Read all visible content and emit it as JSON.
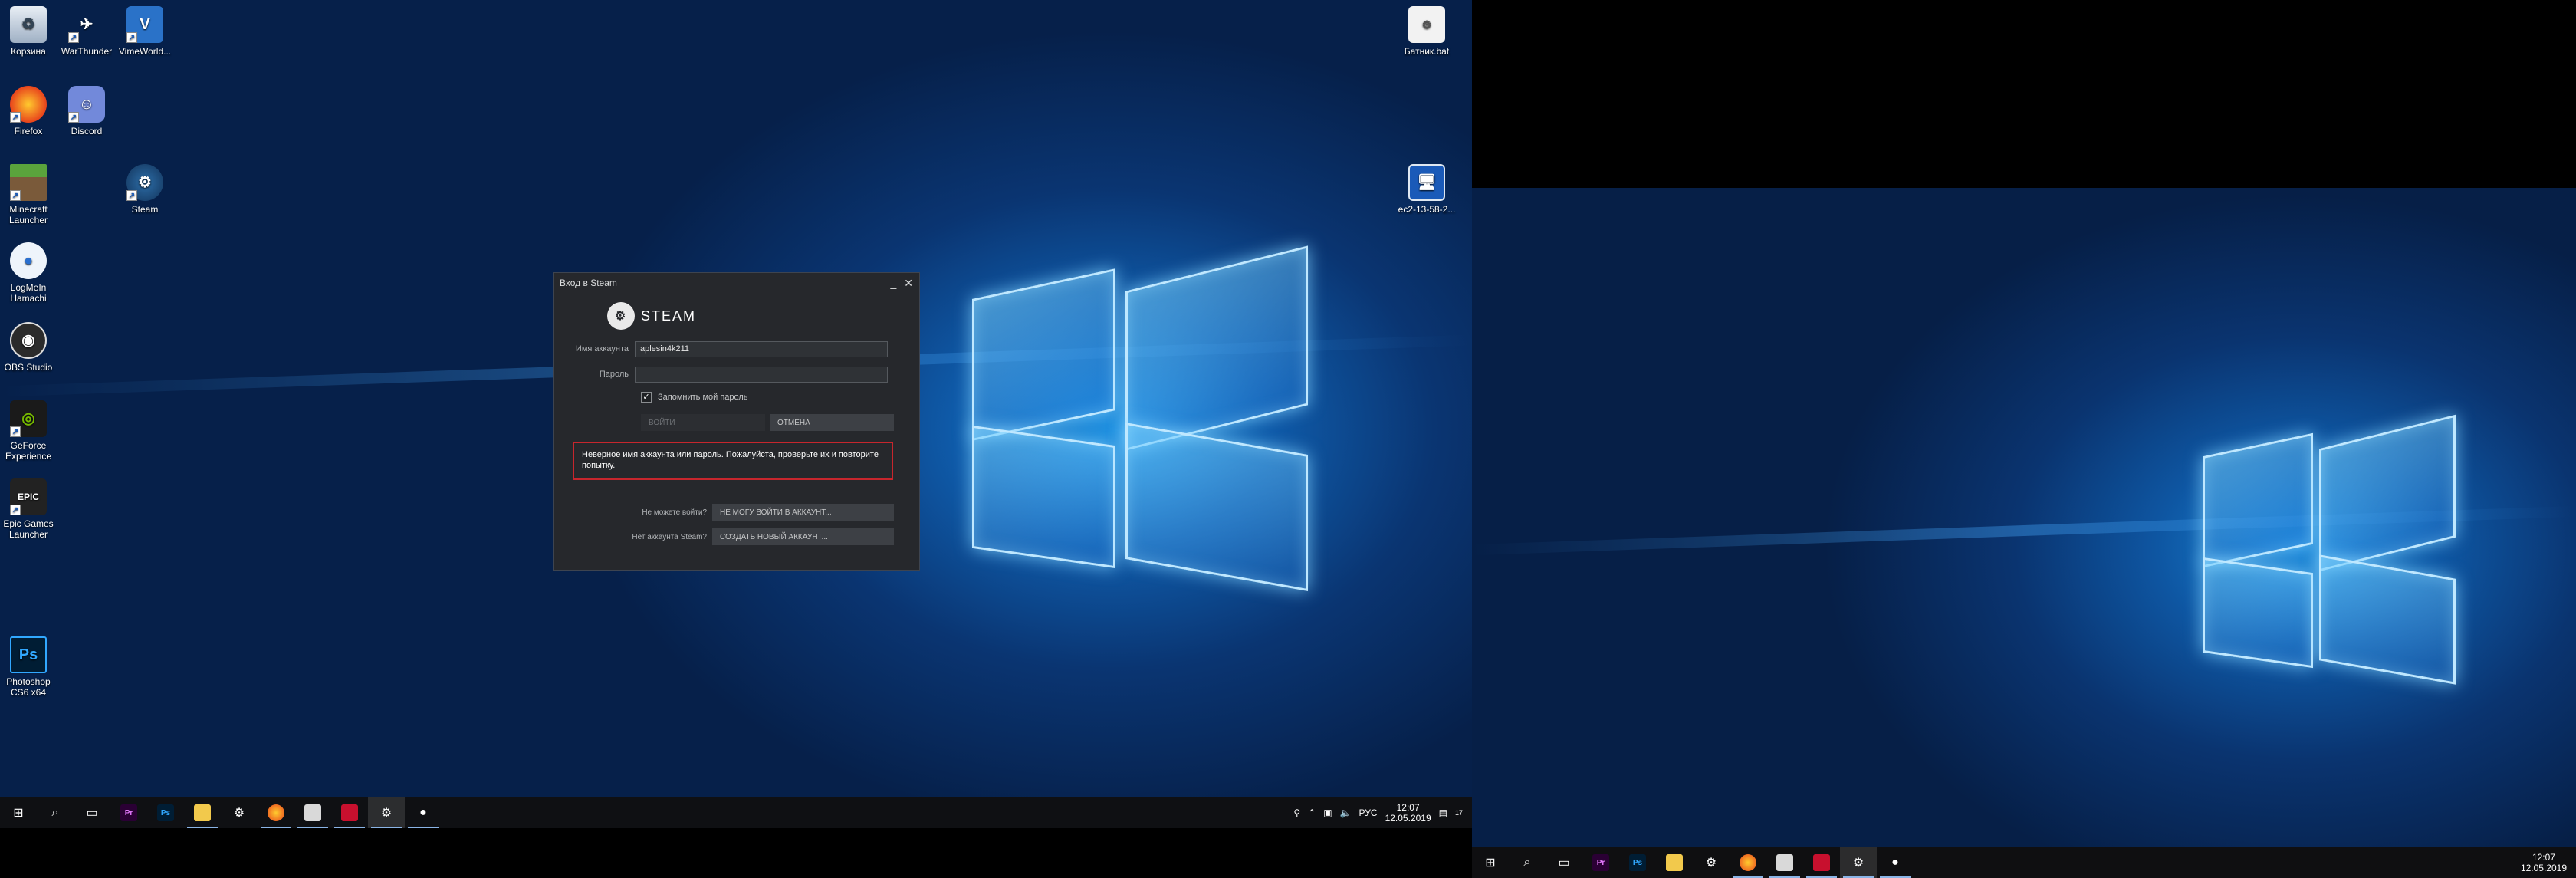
{
  "desktop_left": {
    "icons": [
      {
        "label": "Корзина",
        "icon": "recycle-bin-icon"
      },
      {
        "label": "WarThunder",
        "icon": "warthunder-icon"
      },
      {
        "label": "VimeWorld...",
        "icon": "vimeworld-icon"
      },
      {
        "label": "Firefox",
        "icon": "firefox-icon"
      },
      {
        "label": "Discord",
        "icon": "discord-icon"
      },
      {
        "label": "Minecraft Launcher",
        "icon": "minecraft-icon"
      },
      {
        "label": "Steam",
        "icon": "steam-icon"
      },
      {
        "label": "LogMeIn Hamachi",
        "icon": "hamachi-icon"
      },
      {
        "label": "OBS Studio",
        "icon": "obs-icon"
      },
      {
        "label": "GeForce Experience",
        "icon": "geforce-icon"
      },
      {
        "label": "Epic Games Launcher",
        "icon": "epic-icon"
      },
      {
        "label": "Photoshop CS6 x64",
        "icon": "photoshop-icon"
      },
      {
        "label": "Батник.bat",
        "icon": "batch-file-icon"
      },
      {
        "label": "ec2-13-58-2...",
        "icon": "remote-desktop-icon"
      }
    ]
  },
  "steam_login": {
    "window_title": "Вход в Steam",
    "brand": "STEAM",
    "account_label": "Имя аккаунта",
    "account_value": "aplesin4k211",
    "password_label": "Пароль",
    "password_value": "",
    "remember_label": "Запомнить мой пароль",
    "remember_checked": true,
    "login_button": "ВОЙТИ",
    "cancel_button": "ОТМЕНА",
    "error_text": "Неверное имя аккаунта или пароль. Пожалуйста, проверьте их и повторите попытку.",
    "cant_login_question": "Не можете войти?",
    "cant_login_button": "НЕ МОГУ ВОЙТИ В АККАУНТ...",
    "no_account_question": "Нет аккаунта Steam?",
    "create_account_button": "СОЗДАТЬ НОВЫЙ АККАУНТ..."
  },
  "taskbar": {
    "items": [
      "start-icon",
      "search-icon",
      "task-view-icon",
      "premiere-icon",
      "photoshop-icon",
      "file-explorer-icon",
      "settings-icon",
      "firefox-icon",
      "app-icon",
      "news-app-icon",
      "steam-icon",
      "hamachi-icon"
    ],
    "premiere_glyph": "Pr",
    "photoshop_glyph": "Ps",
    "language": "РУС",
    "time": "12:07",
    "date": "12.05.2019",
    "notification_count": "17"
  },
  "colors": {
    "steam_bg": "#26282c",
    "error_border": "#c7262d",
    "taskbar_bg": "#101012"
  }
}
